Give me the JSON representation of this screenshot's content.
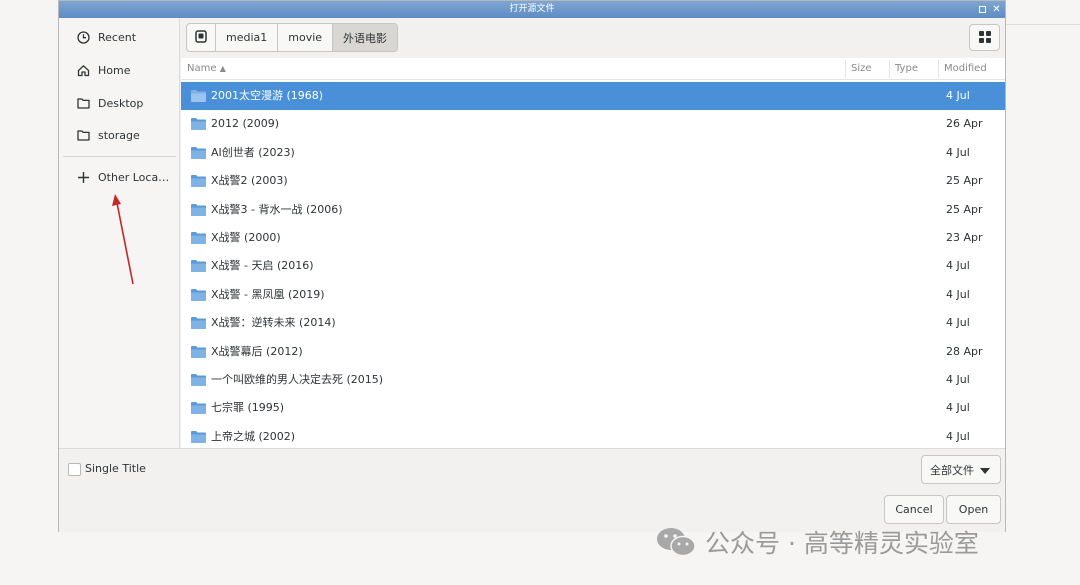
{
  "window": {
    "title": "打开源文件"
  },
  "sidebar": {
    "items": [
      {
        "label": "Recent",
        "icon": "clock-icon"
      },
      {
        "label": "Home",
        "icon": "home-icon"
      },
      {
        "label": "Desktop",
        "icon": "folder-icon"
      },
      {
        "label": "storage",
        "icon": "folder-icon"
      },
      {
        "label": "Other Loca…",
        "icon": "plus-icon"
      }
    ]
  },
  "pathbar": {
    "crumbs": [
      "media1",
      "movie",
      "外语电影"
    ]
  },
  "columns": {
    "name": "Name",
    "size": "Size",
    "type": "Type",
    "modified": "Modified"
  },
  "files": [
    {
      "name": "2001太空漫游 (1968)",
      "modified": "4 Jul"
    },
    {
      "name": "2012 (2009)",
      "modified": "26 Apr"
    },
    {
      "name": "AI创世者 (2023)",
      "modified": "4 Jul"
    },
    {
      "name": "X战警2 (2003)",
      "modified": "25 Apr"
    },
    {
      "name": "X战警3 - 背水一战 (2006)",
      "modified": "25 Apr"
    },
    {
      "name": "X战警 (2000)",
      "modified": "23 Apr"
    },
    {
      "name": "X战警 - 天启 (2016)",
      "modified": "4 Jul"
    },
    {
      "name": "X战警 - 黑凤凰 (2019)",
      "modified": "4 Jul"
    },
    {
      "name": "X战警：逆转未来 (2014)",
      "modified": "4 Jul"
    },
    {
      "name": "X战警幕后 (2012)",
      "modified": "28 Apr"
    },
    {
      "name": "一个叫欧维的男人决定去死 (2015)",
      "modified": "4 Jul"
    },
    {
      "name": "七宗罪 (1995)",
      "modified": "4 Jul"
    },
    {
      "name": "上帝之城 (2002)",
      "modified": "4 Jul"
    }
  ],
  "options": {
    "single_title": "Single Title",
    "filter": "全部文件"
  },
  "buttons": {
    "cancel": "Cancel",
    "open": "Open"
  },
  "watermark": "公众号 · 高等精灵实验室",
  "colors": {
    "selection": "#4a90d9",
    "folder": "#5b9bd8",
    "arrow": "#c62828"
  }
}
